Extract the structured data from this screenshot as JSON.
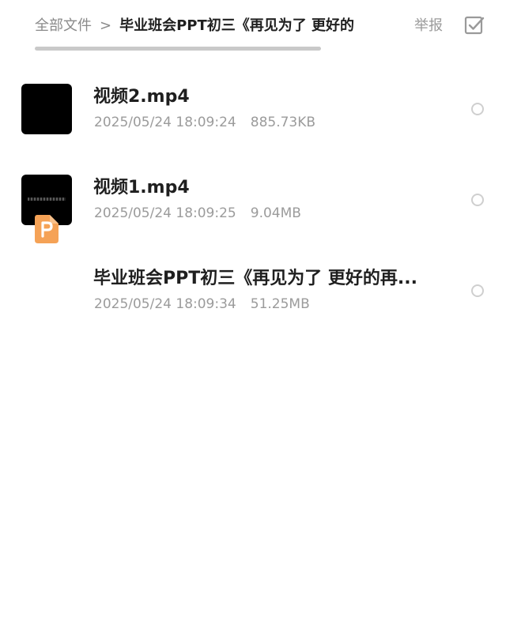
{
  "header": {
    "breadcrumb_root": "全部文件",
    "breadcrumb_separator": ">",
    "current_folder": "毕业班会PPT初三《再见为了 更好的",
    "report_label": "举报",
    "select_icon": "checkbox-icon"
  },
  "files": [
    {
      "name": "视频2.mp4",
      "date": "2025/05/24 18:09:24",
      "size": "885.73KB",
      "icon": "video-thumbnail"
    },
    {
      "name": "视频1.mp4",
      "date": "2025/05/24 18:09:25",
      "size": "9.04MB",
      "icon": "video-thumbnail"
    },
    {
      "name": "毕业班会PPT初三《再见为了 更好的再...",
      "date": "2025/05/24 18:09:34",
      "size": "51.25MB",
      "icon": "ppt-file-icon"
    }
  ],
  "colors": {
    "ppt_orange": "#f5a256",
    "muted_text": "#9b9b9b",
    "primary_text": "#1f1f1f"
  }
}
